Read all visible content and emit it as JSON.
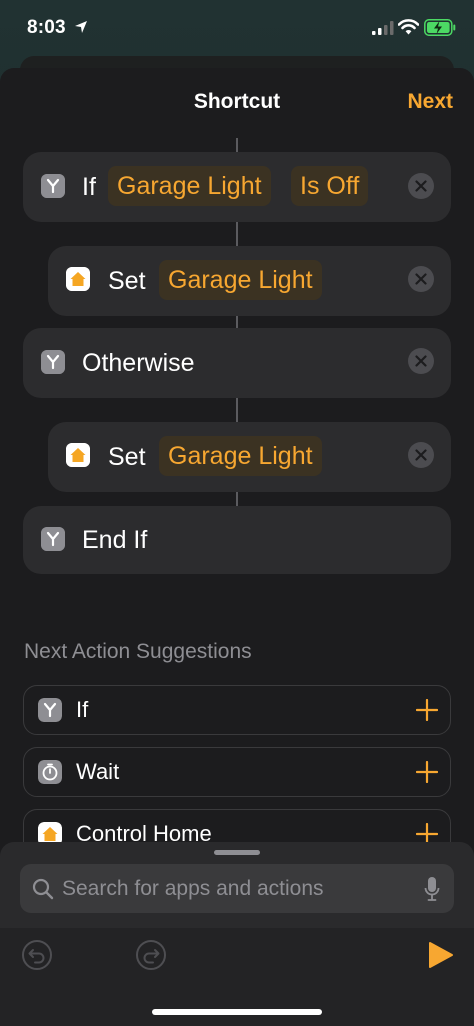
{
  "status_bar": {
    "time": "8:03"
  },
  "nav": {
    "title": "Shortcut",
    "next_label": "Next"
  },
  "actions": [
    {
      "keyword": "If",
      "tokens": [
        "Garage Light",
        "Is Off"
      ]
    },
    {
      "keyword": "Set",
      "tokens": [
        "Garage Light"
      ]
    },
    {
      "keyword": "Otherwise",
      "tokens": []
    },
    {
      "keyword": "Set",
      "tokens": [
        "Garage Light"
      ]
    },
    {
      "keyword": "End If",
      "tokens": []
    }
  ],
  "suggestions": {
    "heading": "Next Action Suggestions",
    "items": [
      {
        "label": "If",
        "icon": "if-icon"
      },
      {
        "label": "Wait",
        "icon": "timer-icon"
      },
      {
        "label": "Control Home",
        "icon": "home-icon"
      }
    ]
  },
  "search": {
    "placeholder": "Search for apps and actions"
  },
  "colors": {
    "accent": "#f7a731",
    "sheet": "#1c1c1e",
    "block": "#2c2c2e",
    "token_bg": "#3b3222"
  }
}
